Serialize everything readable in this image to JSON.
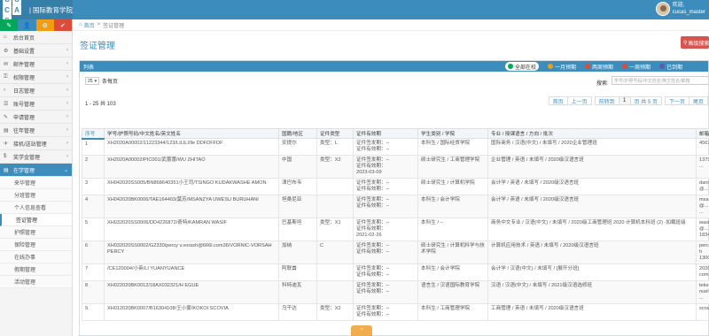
{
  "header": {
    "logo_letters": [
      "C",
      "U",
      "C",
      "A",
      "S"
    ],
    "title": "| 国际教育学院",
    "user_greeting": "欢迎,",
    "user_name": "cucas_master"
  },
  "sidebar": {
    "quick_buttons": [
      {
        "color": "#00a65a",
        "glyph": "✎"
      },
      {
        "color": "#3c8dbc",
        "glyph": "👤"
      },
      {
        "color": "#f39c12",
        "glyph": "⚙"
      },
      {
        "color": "#dd4b39",
        "glyph": "✔"
      }
    ],
    "items": [
      {
        "label": "后台首页",
        "icon": "⌂",
        "caret": ""
      },
      {
        "label": "基础设置",
        "icon": "⚙",
        "caret": "‹"
      },
      {
        "label": "邮件管理",
        "icon": "✉",
        "caret": "‹"
      },
      {
        "label": "权限管理",
        "icon": "⚿",
        "caret": "‹"
      },
      {
        "label": "日志管理",
        "icon": "›",
        "caret": "‹"
      },
      {
        "label": "账号管理",
        "icon": "☰",
        "caret": "‹"
      },
      {
        "label": "申请管理",
        "icon": "✎",
        "caret": "‹"
      },
      {
        "label": "往年管理",
        "icon": "▤",
        "caret": "‹"
      },
      {
        "label": "接机/送站管理",
        "icon": "✈",
        "caret": "‹"
      },
      {
        "label": "奖学金管理",
        "icon": "$",
        "caret": "‹"
      }
    ],
    "open_item": {
      "label": "在学管理",
      "icon": "▤",
      "caret": "⌄"
    },
    "sub_items": [
      "来华管理",
      "分班管理",
      "个人信息查看",
      "签证管理",
      "护照管理",
      "保险管理",
      "在线办事",
      "假期管理",
      "活动管理"
    ],
    "active_sub": 3
  },
  "breadcrumb": {
    "home": "首页",
    "sep": ">",
    "current": "签证管理"
  },
  "page_title": "签证管理",
  "advanced_search_button": "高级搜索",
  "panel": {
    "title": "列表",
    "filters": [
      {
        "label": "全部在校",
        "color": "#00a65a",
        "selected": true
      },
      {
        "label": "一月预期",
        "color": "#f39c12",
        "selected": false
      },
      {
        "label": "两周预期",
        "color": "#dd4b39",
        "selected": false
      },
      {
        "label": "一周预期",
        "color": "#dd4b39",
        "selected": false
      },
      {
        "label": "已到期",
        "color": "#605ca8",
        "selected": false
      }
    ]
  },
  "page_size": {
    "value": "25",
    "suffix": "条每页"
  },
  "search": {
    "label": "搜索:",
    "placeholder": "学号/护照号码/中文姓名/英文姓名/邮箱"
  },
  "table_info": "1 - 25 共 103",
  "pagination": [
    "首页",
    "上一页",
    "前转到",
    "1",
    "页 共 5 页",
    "下一页",
    "尾页"
  ],
  "table": {
    "headers": [
      "序号",
      "学号/护照号码/中文姓名/英文姓名",
      "国籍/地区",
      "证件类型",
      "证件有效期",
      "学生类别 / 学院",
      "专业 / 授课语言 / 方向 / 批次",
      "邮箱 / 手机"
    ],
    "rows": [
      [
        "1",
        "XH2020A00002/11223344/123/LILILI/lle DDFDFFDF",
        "安提尔",
        "类型：L",
        "证件签发期：--\n证件有效期：--",
        "本科生 / 国际经贸学院",
        "国际商务 / 汉语(中文) / 未填写 / 2020企业管理班",
        "456765@123"
      ],
      [
        "2",
        "XH2020A00002/PIC001/武蕾蕾/WU ZHITAO",
        "中国",
        "类型：X2",
        "证件签发期：--\n证件有效期：\n2023-03-09",
        "硕士研究生 / 工商管理学院",
        "企业管理 / 英语 / 未填写 / 2020级汉语言班",
        "13795822852\n..."
      ],
      [
        "3",
        "XH042020SS005/BN868640351小王司/TSINGO KUDAKWASHE AMON",
        "津巴布韦",
        "",
        "证件签发期：--\n证件有效期：--",
        "硕士研究生 / 计算机学院",
        "会计学 / 英语 / 未填写 / 2020级汉语言班",
        "daniel.tsingo@..."
      ],
      [
        "4",
        "XH042020BK0006/TAE164403/莫苏/MSANZYA UWESU BURUHANI",
        "坦桑尼亚",
        "",
        "证件签发期：--\n证件有效期：--",
        "本科生 / 会计学院",
        "会计学 / 英语 / 未填写 / 2020级汉语言班",
        "msanzya20@...\n..."
      ],
      [
        "5",
        "XH032020SS0006/DD4226872/奇特/KAMRAN WASIF",
        "巴基斯坦",
        "类型：X1",
        "证件签发期：--\n证件有效期：\n2021-02-26",
        "本科生 / --",
        "商务中文专业 / 汉语(中文) / 未填写 / 2020级工商管理班 2020 计算机本科班 (2) -加载班级",
        "wasif91573@...\n1834125458"
      ],
      [
        "6",
        "XH032020SS0002/G2330/percy v.vorash@666l.com36/VORNIC-VORSAH PERCY",
        "加纳",
        "C",
        "证件签发期：--\n证件有效期：--",
        "硕士研究生 / 计算机科学与技术学院",
        "计算机应用技术 / 英语 / 未填写 / 2020级汉语言班",
        "percy v.vorash\n13000000000"
      ],
      [
        "7",
        "/CE120004/小英/LI YUANYUANCE",
        "阿联酋",
        "",
        "证件签发期：--\n证件有效期：--",
        "本科生 / 会计学院",
        "会计学 / 汉语(中文) / 未填写 / [展开分班]",
        "2020YS@qq.com"
      ],
      [
        "8",
        "XH022020BK0012/18AX032321/H EGUE",
        "科特迪瓦",
        "",
        "证件签发期：--\n证件有效期：--",
        "语言生 / 汉语国际教育学院",
        "汉语 / 汉语(中文) / 未填写 / 2021级汉语选修班",
        "tekeanemmanuel\n..."
      ],
      [
        "9",
        "XH012020BK0007/B16304108/王小蒙/KOKOI SCOVIA",
        "乌干达",
        "类型：X2",
        "证件签发期：--\n证件有效期：--",
        "本科生 / 工商管理学院",
        "工商管理 / 英语 / 未填写 / 2020级汉语言班",
        "scovyk43@..."
      ]
    ]
  },
  "collapse_glyph": "⌃"
}
